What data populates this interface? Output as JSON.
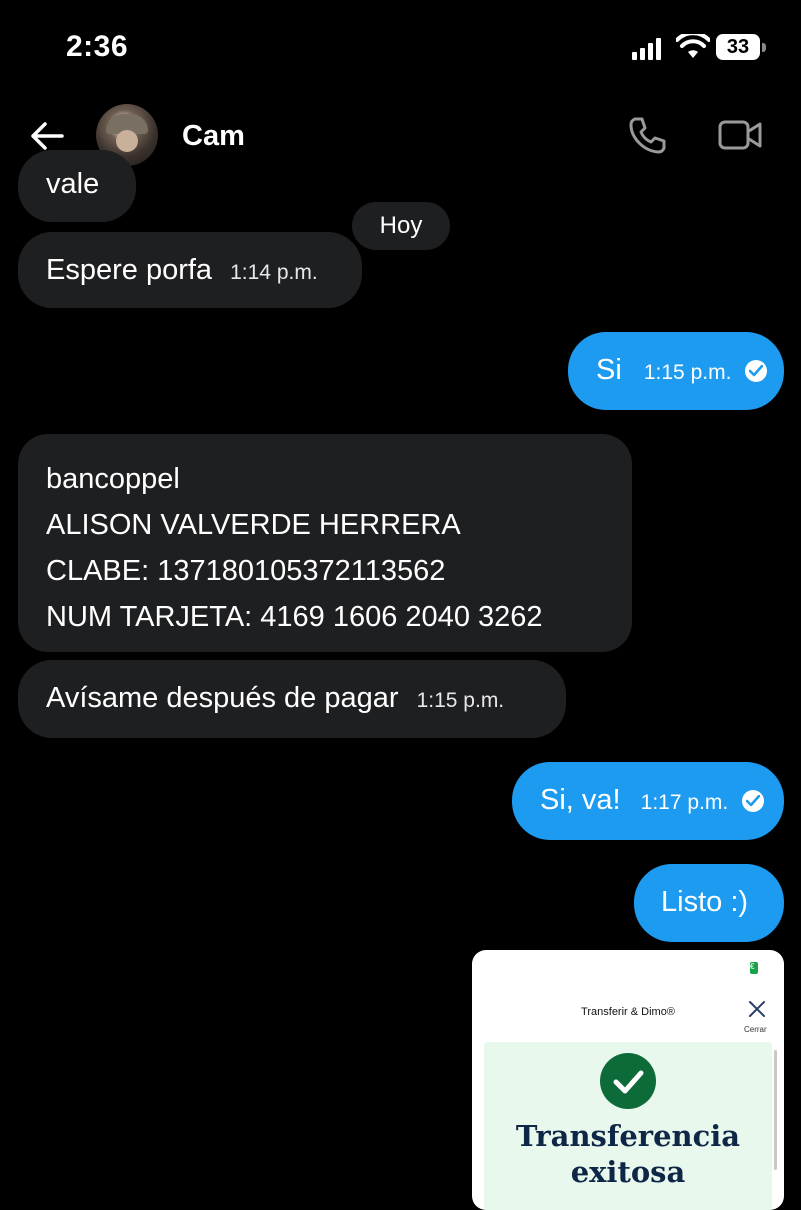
{
  "status_bar": {
    "time": "2:36",
    "battery": "33"
  },
  "header": {
    "contact_name": "Cam"
  },
  "chat": {
    "day_separator": "Hoy",
    "messages": [
      {
        "dir": "in",
        "text": "vale",
        "time": ""
      },
      {
        "dir": "in",
        "text": "Espere porfa",
        "time": "1:14 p.m."
      },
      {
        "dir": "out",
        "text": "Si",
        "time": "1:15 p.m."
      },
      {
        "dir": "in",
        "lines": [
          "bancoppel",
          "ALISON VALVERDE HERRERA",
          "CLABE: 137180105372113562",
          "NUM TARJETA: 4169 1606 2040 3262"
        ]
      },
      {
        "dir": "in",
        "text": "Avísame después de pagar",
        "time": "1:15 p.m."
      },
      {
        "dir": "out",
        "text": "Si, va!",
        "time": "1:17 p.m."
      },
      {
        "dir": "out",
        "text": "Listo :)",
        "time": ""
      }
    ]
  },
  "attachment": {
    "header_title": "Transferir & Dimo®",
    "close_label": "Cerrar",
    "headline_line1": "Transferencia",
    "headline_line2": "exitosa",
    "badge": "€"
  },
  "colors": {
    "outgoing_bubble": "#1d9bf0",
    "incoming_bubble": "#1e1f21",
    "background": "#000000"
  }
}
